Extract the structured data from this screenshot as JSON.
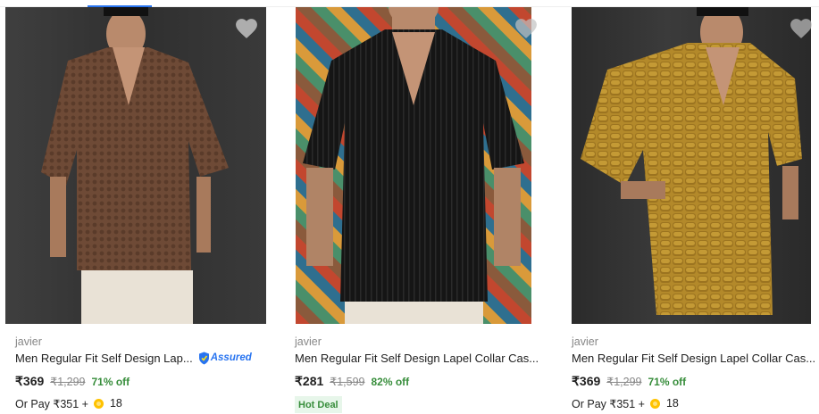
{
  "products": [
    {
      "brand": "javier",
      "title": "Men Regular Fit Self Design Lap...",
      "assured_label": "Assured",
      "price": "₹369",
      "mrp": "₹1,299",
      "discount": "71% off",
      "pay_prefix": "Or Pay ₹351 +",
      "coins": "18",
      "shirt_color": "#6e4a36"
    },
    {
      "brand": "javier",
      "title": "Men Regular Fit Self Design Lapel Collar Cas...",
      "price": "₹281",
      "mrp": "₹1,599",
      "discount": "82% off",
      "badge": "Hot Deal",
      "shirt_color": "#151515"
    },
    {
      "brand": "javier",
      "title": "Men Regular Fit Self Design Lapel Collar Cas...",
      "price": "₹369",
      "mrp": "₹1,299",
      "discount": "71% off",
      "pay_prefix": "Or Pay ₹351 +",
      "coins": "18",
      "shirt_color": "#b3892a"
    }
  ],
  "colors": {
    "price_discount": "#388e3c",
    "assured_blue": "#2874f0",
    "muted": "#878787",
    "coin": "#ffc200"
  },
  "icons": [
    "heart-icon",
    "assured-shield-icon",
    "supercoin-icon"
  ]
}
